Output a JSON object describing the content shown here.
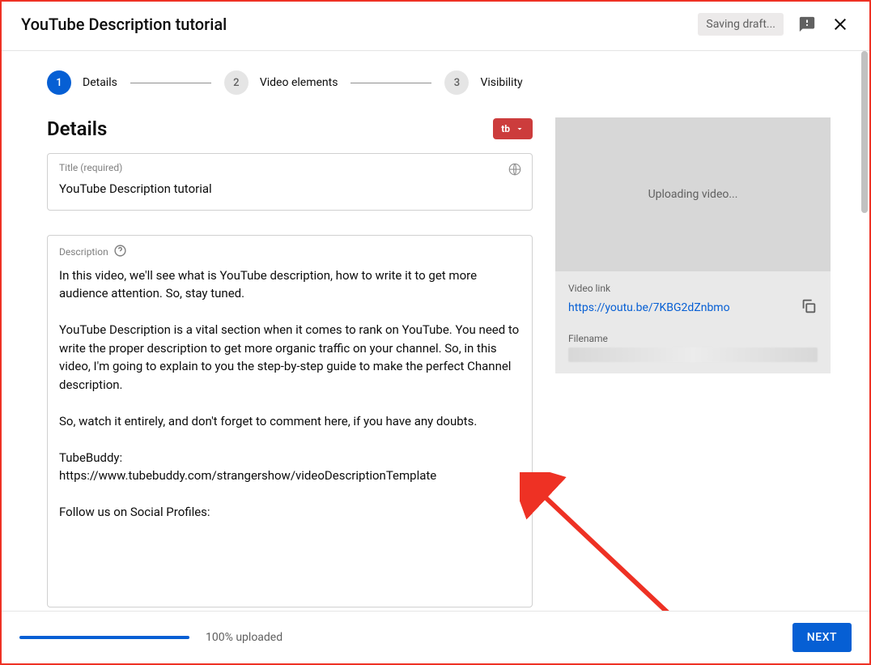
{
  "header": {
    "title": "YouTube Description tutorial",
    "saving": "Saving draft..."
  },
  "stepper": {
    "steps": [
      {
        "num": "1",
        "label": "Details",
        "active": true
      },
      {
        "num": "2",
        "label": "Video elements",
        "active": false
      },
      {
        "num": "3",
        "label": "Visibility",
        "active": false
      }
    ]
  },
  "details": {
    "heading": "Details",
    "tb_label": "tb",
    "title_field": {
      "label": "Title (required)",
      "value": "YouTube Description tutorial"
    },
    "description_field": {
      "label": "Description",
      "value": "In this video, we'll see what is YouTube description, how to write it to get more audience attention. So, stay tuned.\n\nYouTube Description is a vital section when it comes to rank on YouTube. You need to write the proper description to get more organic traffic on your channel. So, in this video, I'm going to explain to you the step-by-step guide to make the perfect Channel description.\n\nSo, watch it entirely, and don't forget to comment here, if you have any doubts.\n\nTubeBuddy:\nhttps://www.tubebuddy.com/strangershow/videoDescriptionTemplate\n\nFollow us on Social Profiles:"
    }
  },
  "preview": {
    "uploading_text": "Uploading video...",
    "video_link_label": "Video link",
    "video_link": "https://youtu.be/7KBG2dZnbmo",
    "filename_label": "Filename"
  },
  "footer": {
    "progress_text": "100% uploaded",
    "progress_pct": 100,
    "next_label": "NEXT"
  }
}
